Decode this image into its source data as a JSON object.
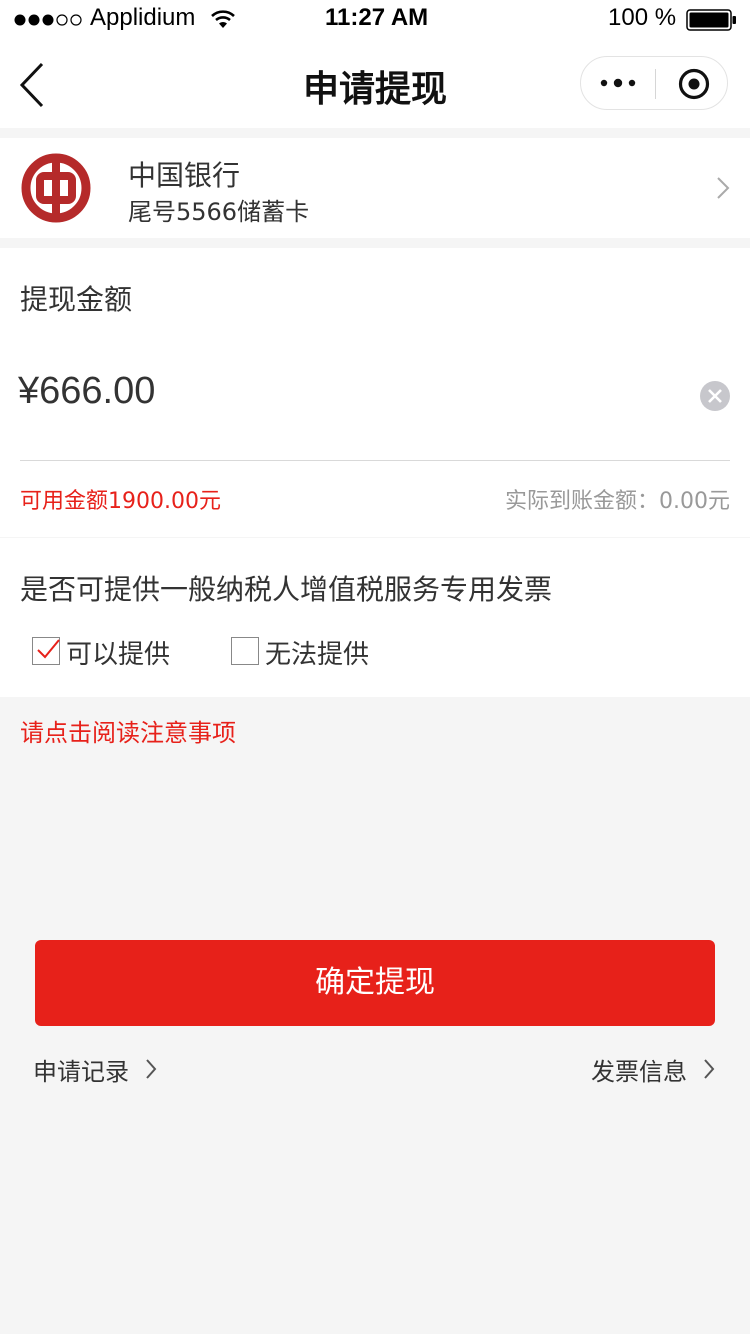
{
  "status_bar": {
    "carrier": "Applidium",
    "time": "11:27 AM",
    "battery": "100 %",
    "signal_icon": "signal-dots-icon",
    "wifi_icon": "wifi-icon",
    "battery_icon": "battery-icon"
  },
  "nav": {
    "title": "申请提现",
    "back_icon": "back-chevron-icon",
    "more_icon": "more-dots-icon",
    "close_icon": "target-close-icon"
  },
  "bank": {
    "name": "中国银行",
    "card": "尾号5566储蓄卡",
    "logo_icon": "bank-of-china-logo-icon",
    "chevron_icon": "chevron-right-icon"
  },
  "amount": {
    "label": "提现金额",
    "value": "¥666.00",
    "clear_icon": "clear-circle-icon",
    "available": "可用金额1900.00元",
    "actual": "实际到账金额：0.00元"
  },
  "invoice": {
    "question": "是否可提供一般纳税人增值税服务专用发票",
    "options": [
      {
        "label": "可以提供",
        "checked": true
      },
      {
        "label": "无法提供",
        "checked": false
      }
    ]
  },
  "notice_link": "请点击阅读注意事项",
  "confirm_button": "确定提现",
  "links": {
    "records": "申请记录",
    "invoice_info": "发票信息"
  },
  "colors": {
    "accent": "#e7211a",
    "bank_red": "#b52a2a",
    "muted": "#999999"
  }
}
